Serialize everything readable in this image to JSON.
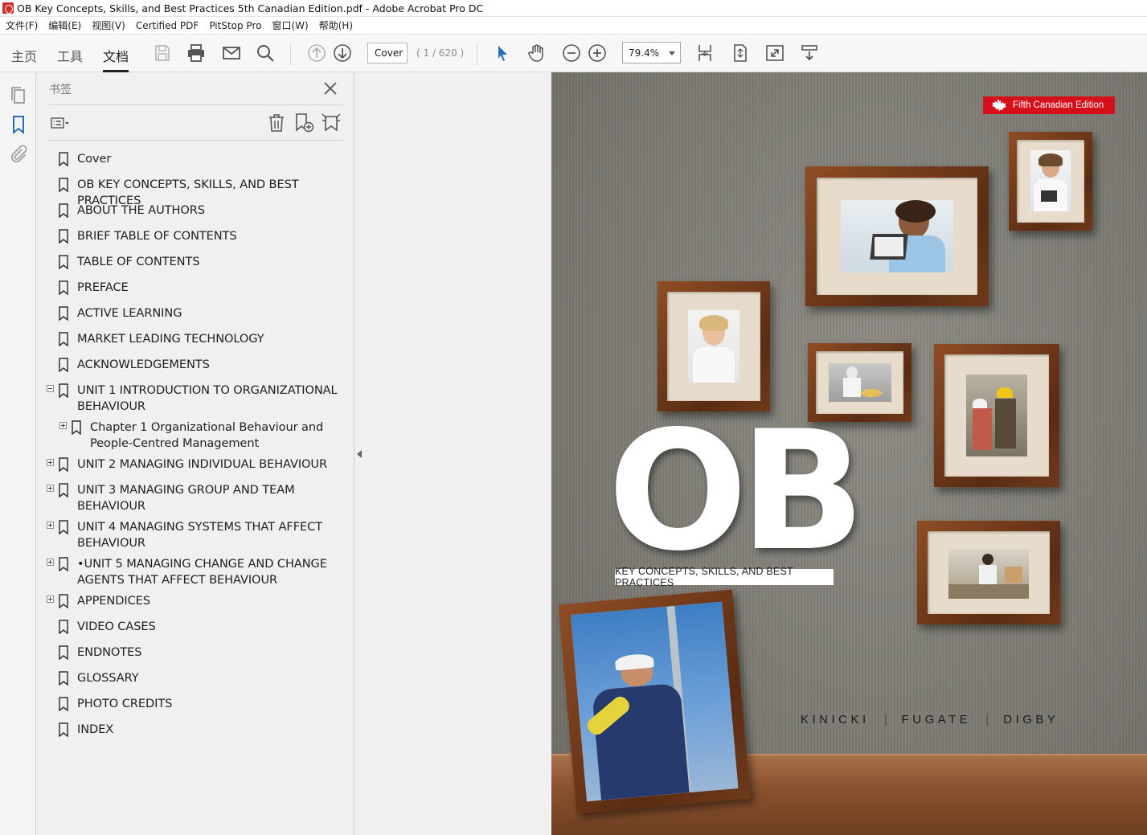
{
  "window": {
    "title": "OB Key Concepts, Skills, and Best Practices 5th Canadian Edition.pdf - Adobe Acrobat Pro DC"
  },
  "menu": [
    "文件(F)",
    "编辑(E)",
    "视图(V)",
    "Certified PDF",
    "PitStop Pro",
    "窗口(W)",
    "帮助(H)"
  ],
  "toolbar": {
    "tabs": [
      "主页",
      "工具",
      "文档"
    ],
    "active_tab": "文档",
    "page_value": "Cover",
    "page_count": "( 1 / 620 )",
    "zoom": "79.4%"
  },
  "bookmarks_panel": {
    "title": "书签",
    "items": [
      {
        "label": "Cover"
      },
      {
        "label": "OB KEY CONCEPTS, SKILLS, AND BEST PRACTICES"
      },
      {
        "label": "ABOUT THE AUTHORS"
      },
      {
        "label": "BRIEF TABLE OF CONTENTS"
      },
      {
        "label": "TABLE OF CONTENTS"
      },
      {
        "label": "PREFACE"
      },
      {
        "label": "ACTIVE LEARNING"
      },
      {
        "label": "MARKET LEADING TECHNOLOGY"
      },
      {
        "label": "ACKNOWLEDGEMENTS"
      },
      {
        "label_line1": "UNIT 1  INTRODUCTION TO ORGANIZATIONAL",
        "label_line2": "BEHAVIOUR",
        "expander": "minus"
      },
      {
        "label_line1": "Chapter 1 Organizational Behaviour and",
        "label_line2": "People-Centred Management",
        "expander": "plus"
      },
      {
        "label": "UNIT 2  MANAGING INDIVIDUAL BEHAVIOUR",
        "expander": "plus"
      },
      {
        "label_line1": "UNIT 3  MANAGING GROUP AND TEAM",
        "label_line2": "BEHAVIOUR",
        "expander": "plus"
      },
      {
        "label_line1": "UNIT 4  MANAGING SYSTEMS THAT AFFECT",
        "label_line2": "BEHAVIOUR",
        "expander": "plus"
      },
      {
        "label_line1": "•UNIT 5 MANAGING CHANGE AND CHANGE",
        "label_line2": "AGENTS THAT AFFECT BEHAVIOUR",
        "expander": "plus"
      },
      {
        "label": "APPENDICES",
        "expander": "plus"
      },
      {
        "label": "VIDEO CASES"
      },
      {
        "label": "ENDNOTES"
      },
      {
        "label": "GLOSSARY"
      },
      {
        "label": "PHOTO CREDITS"
      },
      {
        "label": "INDEX"
      }
    ]
  },
  "cover": {
    "edition_badge": "Fifth Canadian Edition",
    "title": "OB",
    "subtitle": "KEY CONCEPTS, SKILLS, AND BEST PRACTICES",
    "authors": [
      "KINICKI",
      "FUGATE",
      "DIGBY"
    ],
    "badge_color": "#d5101b"
  }
}
